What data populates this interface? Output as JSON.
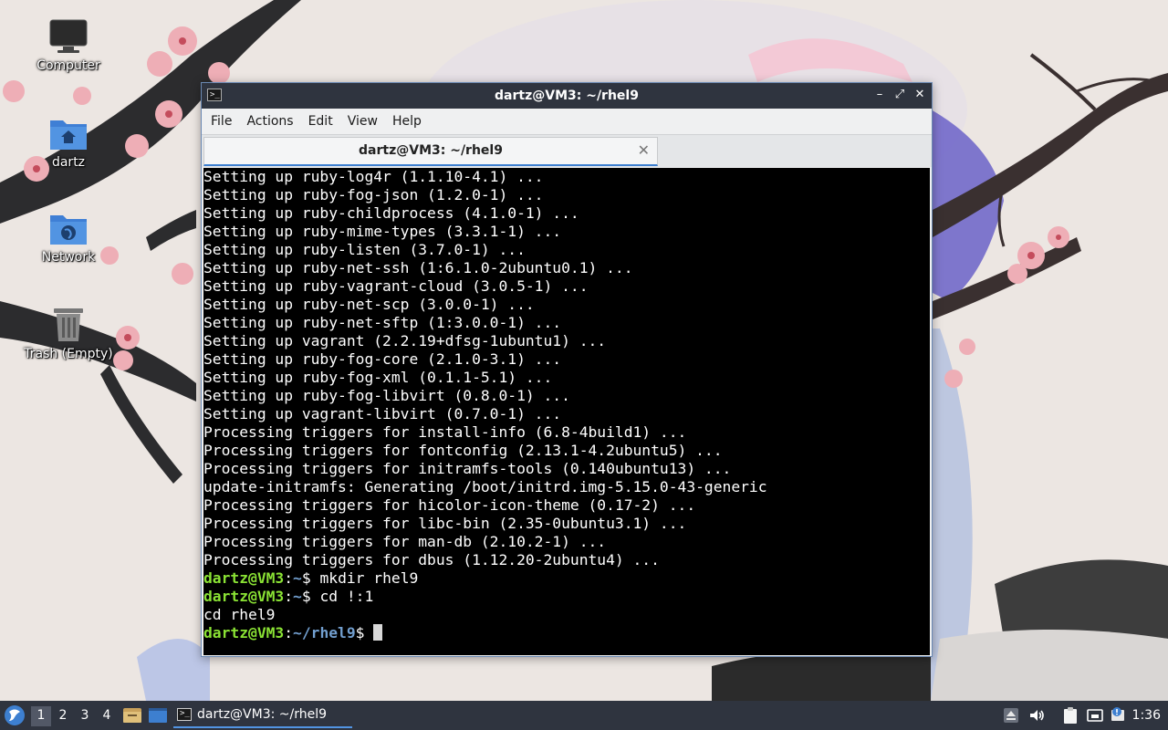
{
  "desktop": {
    "icons": [
      {
        "label": "Computer",
        "icon": "monitor-icon"
      },
      {
        "label": "dartz",
        "icon": "home-folder-icon"
      },
      {
        "label": "Network",
        "icon": "network-folder-icon"
      },
      {
        "label": "Trash (Empty)",
        "icon": "trash-icon"
      }
    ]
  },
  "window": {
    "title": "dartz@VM3: ~/rhel9",
    "controls": {
      "minimize": "–",
      "maximize": "⤢",
      "close": "✕"
    },
    "menu": [
      "File",
      "Actions",
      "Edit",
      "View",
      "Help"
    ],
    "tab": {
      "label": "dartz@VM3: ~/rhel9",
      "close": "✕"
    }
  },
  "terminal": {
    "lines": [
      "Setting up ruby-log4r (1.1.10-4.1) ...",
      "Setting up ruby-fog-json (1.2.0-1) ...",
      "Setting up ruby-childprocess (4.1.0-1) ...",
      "Setting up ruby-mime-types (3.3.1-1) ...",
      "Setting up ruby-listen (3.7.0-1) ...",
      "Setting up ruby-net-ssh (1:6.1.0-2ubuntu0.1) ...",
      "Setting up ruby-vagrant-cloud (3.0.5-1) ...",
      "Setting up ruby-net-scp (3.0.0-1) ...",
      "Setting up ruby-net-sftp (1:3.0.0-1) ...",
      "Setting up vagrant (2.2.19+dfsg-1ubuntu1) ...",
      "Setting up ruby-fog-core (2.1.0-3.1) ...",
      "Setting up ruby-fog-xml (0.1.1-5.1) ...",
      "Setting up ruby-fog-libvirt (0.8.0-1) ...",
      "Setting up vagrant-libvirt (0.7.0-1) ...",
      "Processing triggers for install-info (6.8-4build1) ...",
      "Processing triggers for fontconfig (2.13.1-4.2ubuntu5) ...",
      "Processing triggers for initramfs-tools (0.140ubuntu13) ...",
      "update-initramfs: Generating /boot/initrd.img-5.15.0-43-generic",
      "Processing triggers for hicolor-icon-theme (0.17-2) ...",
      "Processing triggers for libc-bin (2.35-0ubuntu3.1) ...",
      "Processing triggers for man-db (2.10.2-1) ...",
      "Processing triggers for dbus (1.12.20-2ubuntu4) ..."
    ],
    "prompt1": {
      "user": "dartz@VM3",
      "sep": ":",
      "path": "~",
      "dollar": "$ ",
      "cmd": "mkdir rhel9"
    },
    "prompt2": {
      "user": "dartz@VM3",
      "sep": ":",
      "path": "~",
      "dollar": "$ ",
      "cmd": "cd !:1"
    },
    "echo": "cd rhel9",
    "prompt3": {
      "user": "dartz@VM3",
      "sep": ":",
      "path": "~/rhel9",
      "dollar": "$ "
    }
  },
  "taskbar": {
    "workspaces": [
      "1",
      "2",
      "3",
      "4"
    ],
    "active_workspace": "1",
    "task_label": "dartz@VM3: ~/rhel9",
    "clock": "1:36"
  },
  "colors": {
    "prompt_user": "#8ae234",
    "prompt_path": "#729fcf",
    "panel": "#2f343f",
    "accent": "#5294e2"
  }
}
